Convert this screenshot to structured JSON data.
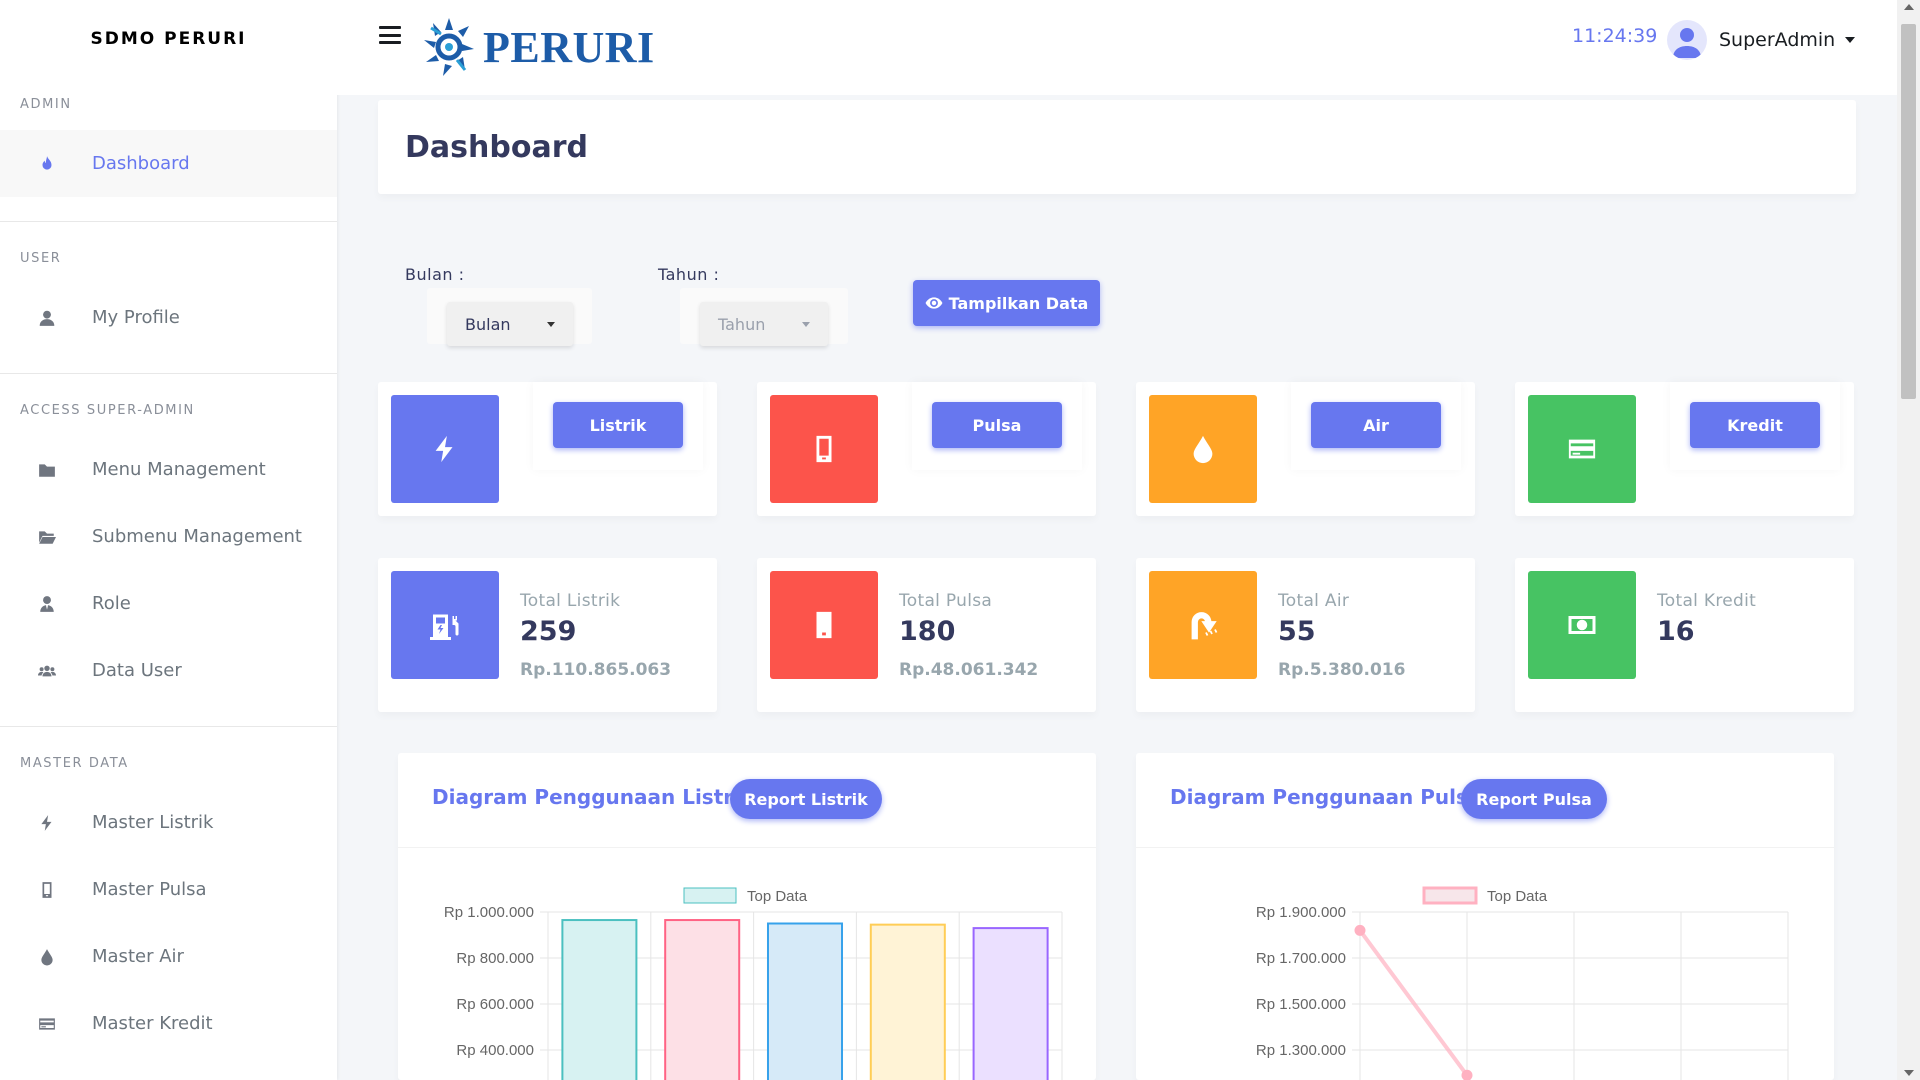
{
  "sidebar": {
    "brand": "SDMO PERURI",
    "sections": [
      {
        "header": "ADMIN",
        "items": [
          {
            "label": "Dashboard",
            "icon": "fire-icon",
            "active": true
          }
        ]
      },
      {
        "header": "USER",
        "items": [
          {
            "label": "My Profile",
            "icon": "user-icon"
          }
        ]
      },
      {
        "header": "ACCESS SUPER-ADMIN",
        "items": [
          {
            "label": "Menu Management",
            "icon": "folder-icon"
          },
          {
            "label": "Submenu Management",
            "icon": "folder-open-icon"
          },
          {
            "label": "Role",
            "icon": "user-tie-icon"
          },
          {
            "label": "Data User",
            "icon": "users-icon"
          }
        ]
      },
      {
        "header": "MASTER DATA",
        "items": [
          {
            "label": "Master Listrik",
            "icon": "bolt-icon"
          },
          {
            "label": "Master Pulsa",
            "icon": "mobile-icon"
          },
          {
            "label": "Master Air",
            "icon": "tint-icon"
          },
          {
            "label": "Master Kredit",
            "icon": "credit-card-icon"
          }
        ]
      }
    ]
  },
  "topbar": {
    "logo_text": "PERURI",
    "clock": "11:24:39",
    "user_name": "SuperAdmin"
  },
  "page": {
    "title": "Dashboard"
  },
  "filters": {
    "bulan_label": "Bulan :",
    "bulan_value": "Bulan",
    "tahun_label": "Tahun :",
    "tahun_value": "Tahun",
    "show_button": "Tampilkan Data"
  },
  "categories": [
    {
      "label": "Listrik",
      "color": "#6777ef",
      "icon": "bolt-icon"
    },
    {
      "label": "Pulsa",
      "color": "#fc544b",
      "icon": "mobile-icon"
    },
    {
      "label": "Air",
      "color": "#ffa426",
      "icon": "tint-icon"
    },
    {
      "label": "Kredit",
      "color": "#47c363",
      "icon": "credit-card-icon"
    }
  ],
  "stats": [
    {
      "label": "Total Listrik",
      "value": "259",
      "sub": "Rp.110.865.063",
      "color": "#6777ef",
      "icon": "charging-station-icon"
    },
    {
      "label": "Total Pulsa",
      "value": "180",
      "sub": "Rp.48.061.342",
      "color": "#fc544b",
      "icon": "mobile-alt-icon"
    },
    {
      "label": "Total Air",
      "value": "55",
      "sub": "Rp.5.380.016",
      "color": "#ffa426",
      "icon": "shower-icon"
    },
    {
      "label": "Total Kredit",
      "value": "16",
      "sub": "",
      "color": "#47c363",
      "icon": "money-bill-icon"
    }
  ],
  "charts": {
    "listrik": {
      "title": "Diagram Penggunaan Listrik",
      "button": "Report Listrik"
    },
    "pulsa": {
      "title": "Diagram Penggunaan Pulsa",
      "button": "Report Pulsa"
    }
  },
  "chart_data": [
    {
      "type": "bar",
      "legend": "Top Data",
      "ytick_labels": [
        "Rp 1.000.000",
        "Rp 800.000",
        "Rp 600.000",
        "Rp 400.000"
      ],
      "ylim": [
        400000,
        1000000
      ],
      "values": [
        965000,
        965000,
        950000,
        945000,
        930000
      ],
      "bar_fill": [
        "#d7f2f2",
        "#fde0e6",
        "#d6eaf8",
        "#fff3d6",
        "#ebe0ff"
      ],
      "bar_stroke": [
        "#4bc0c0",
        "#ff6384",
        "#36a2eb",
        "#ffcd56",
        "#9966ff"
      ],
      "grid": true,
      "legend_position": "top"
    },
    {
      "type": "line",
      "legend": "Top Data",
      "ytick_labels": [
        "Rp 1.900.000",
        "Rp 1.700.000",
        "Rp 1.500.000",
        "Rp 1.300.000"
      ],
      "ylim": [
        1300000,
        1900000
      ],
      "values": [
        1820000,
        1190000
      ],
      "line_color": "#ffb1c1",
      "grid": true,
      "legend_position": "top"
    }
  ]
}
